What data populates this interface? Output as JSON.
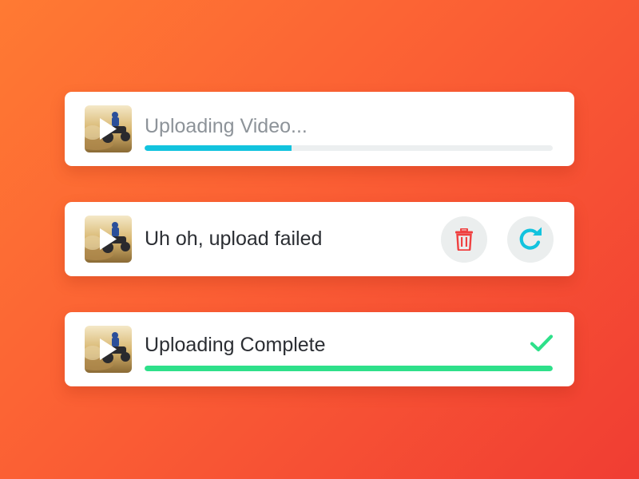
{
  "uploads": [
    {
      "status": "in-progress",
      "title": "Uploading Video...",
      "progress": 0.36,
      "thumbnail": "atv-rider-video-thumbnail",
      "icon": "play-icon",
      "accent_color": "#12c3de"
    },
    {
      "status": "failed",
      "title": "Uh oh, upload failed",
      "thumbnail": "atv-rider-video-thumbnail",
      "icon": "play-icon",
      "actions": [
        {
          "name": "delete",
          "icon": "trash-icon",
          "color": "#f04040"
        },
        {
          "name": "retry",
          "icon": "refresh-icon",
          "color": "#12c3de"
        }
      ]
    },
    {
      "status": "complete",
      "title": "Uploading Complete",
      "progress": 1.0,
      "thumbnail": "atv-rider-video-thumbnail",
      "icon": "play-icon",
      "status_icon": "checkmark-icon",
      "accent_color": "#2ee08a"
    }
  ],
  "colors": {
    "background_start": "#ff7a33",
    "background_end": "#f03d33",
    "card": "#ffffff",
    "track": "#eceff0",
    "button_bg": "#ebeeee"
  }
}
